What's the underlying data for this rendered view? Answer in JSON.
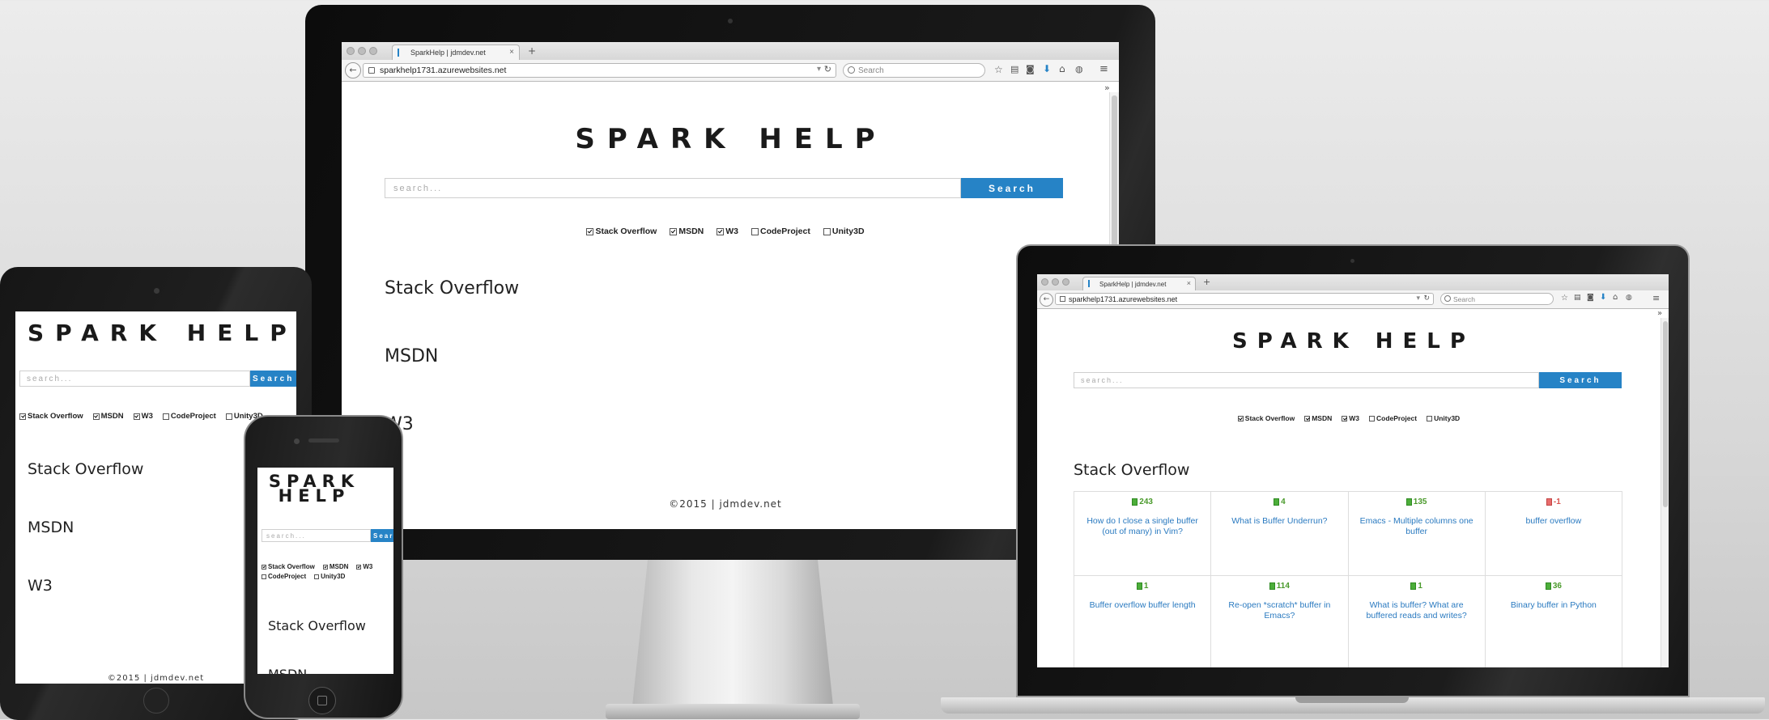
{
  "site": {
    "title": "SPARK HELP",
    "search_placeholder": "search...",
    "search_button": "Search",
    "checkboxes": [
      {
        "label": "Stack Overflow",
        "checked": true
      },
      {
        "label": "MSDN",
        "checked": true
      },
      {
        "label": "W3",
        "checked": true
      },
      {
        "label": "CodeProject",
        "checked": false
      },
      {
        "label": "Unity3D",
        "checked": false
      }
    ],
    "sections": [
      "Stack Overflow",
      "MSDN",
      "W3"
    ],
    "footer": "©2015 | jdmdev.net"
  },
  "browser": {
    "tab_title": "SparkHelp | jdmdev.net",
    "url": "sparkhelp1731.azurewebsites.net",
    "search_placeholder": "Search"
  },
  "results": [
    {
      "score": "243",
      "positive": true,
      "question": "How do I close a single buffer (out of many) in Vim?"
    },
    {
      "score": "4",
      "positive": true,
      "question": "What is Buffer Underrun?"
    },
    {
      "score": "135",
      "positive": true,
      "question": "Emacs - Multiple columns one buffer"
    },
    {
      "score": "-1",
      "positive": false,
      "question": "buffer overflow"
    },
    {
      "score": "1",
      "positive": true,
      "question": "Buffer overflow buffer length"
    },
    {
      "score": "114",
      "positive": true,
      "question": "Re-open *scratch* buffer in Emacs?"
    },
    {
      "score": "1",
      "positive": true,
      "question": "What is buffer? What are buffered reads and writes?"
    },
    {
      "score": "36",
      "positive": true,
      "question": "Binary buffer in Python"
    }
  ],
  "icons": [
    "back-arrow-icon",
    "lock-icon",
    "reload-icon",
    "search-icon",
    "bookmark-star-icon",
    "clipboard-icon",
    "pocket-icon",
    "download-icon",
    "home-icon",
    "chat-icon",
    "hamburger-menu-icon",
    "overflow-chevron-icon",
    "home-button-icon",
    "camera-icon"
  ],
  "colors": {
    "accent": "#2683c6",
    "link": "#2a7ac0",
    "positive": "#4cae3a",
    "negative": "#e86c6c"
  }
}
